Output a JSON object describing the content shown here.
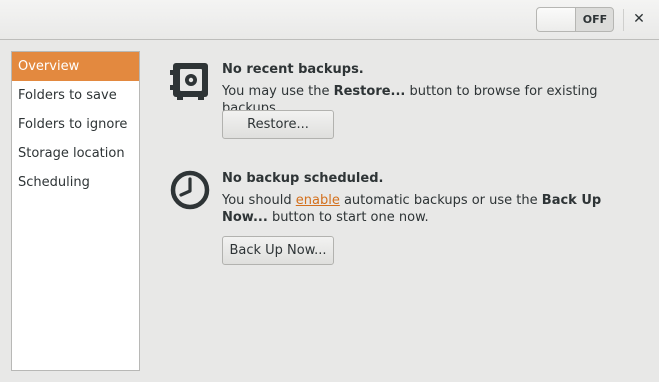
{
  "header": {
    "toggle": {
      "state_label": "OFF"
    },
    "close_glyph": "✕"
  },
  "sidebar": {
    "items": [
      {
        "label": "Overview",
        "selected": true
      },
      {
        "label": "Folders to save",
        "selected": false
      },
      {
        "label": "Folders to ignore",
        "selected": false
      },
      {
        "label": "Storage location",
        "selected": false
      },
      {
        "label": "Scheduling",
        "selected": false
      }
    ]
  },
  "restore_section": {
    "icon": "safe-icon",
    "title": "No recent backups.",
    "text_prefix": "You may use the ",
    "text_bold": "Restore...",
    "text_suffix": " button to browse for existing backups.",
    "button_label": "Restore..."
  },
  "schedule_section": {
    "icon": "clock-icon",
    "title": "No backup scheduled.",
    "text_prefix": "You should ",
    "link_text": "enable",
    "text_middle": " automatic backups or use the ",
    "text_bold": "Back Up Now...",
    "text_suffix": " button to start one now.",
    "button_label": "Back Up Now..."
  },
  "colors": {
    "accent": "#e3893f",
    "link": "#d3701d",
    "background": "#e8e8e7"
  }
}
